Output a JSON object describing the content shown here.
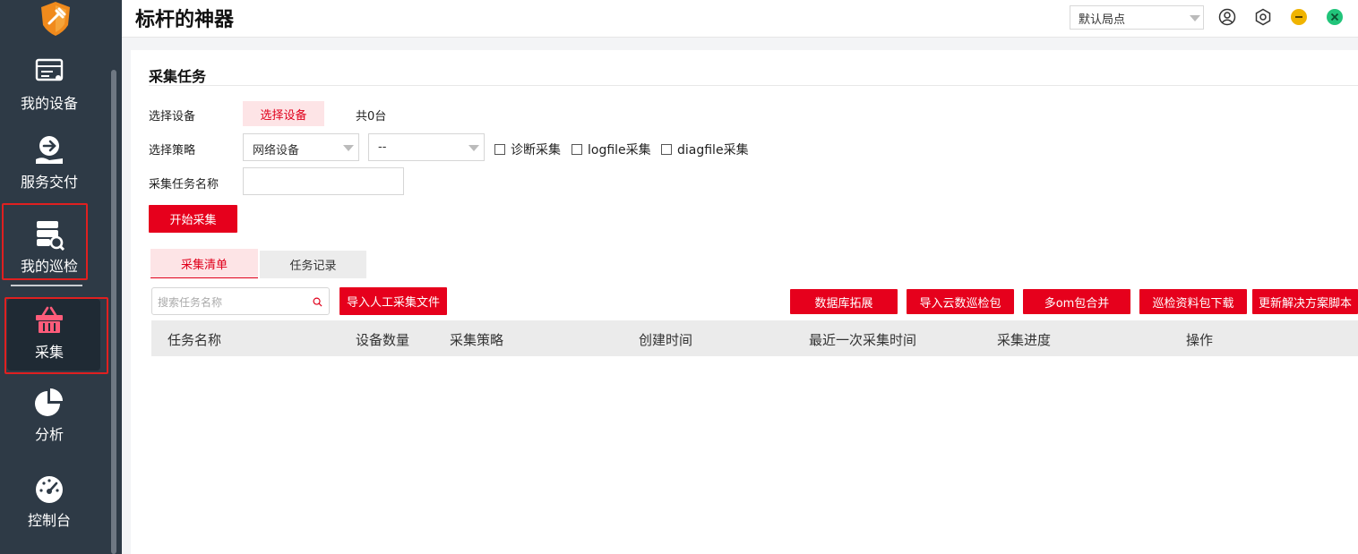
{
  "app": {
    "title": "标杆的神器"
  },
  "header": {
    "site_select": "默认局点",
    "icons": [
      "user-icon",
      "settings-icon",
      "minimize-icon",
      "close-icon"
    ]
  },
  "sidebar": {
    "items": [
      {
        "label": "我的设备",
        "icon": "device-list-icon"
      },
      {
        "label": "服务交付",
        "icon": "service-delivery-icon"
      },
      {
        "label": "我的巡检",
        "icon": "inspection-icon",
        "highlighted": true
      },
      {
        "label": "采集",
        "icon": "collect-basket-icon",
        "active": true,
        "highlighted": true
      },
      {
        "label": "分析",
        "icon": "pie-chart-icon"
      },
      {
        "label": "控制台",
        "icon": "dashboard-gauge-icon"
      }
    ]
  },
  "panel": {
    "title": "采集任务",
    "select_device_label": "选择设备",
    "select_device_button": "选择设备",
    "device_count": "共0台",
    "strategy_label": "选择策略",
    "strategy_value": "网络设备",
    "strategy_sub_value": "--",
    "checkboxes": [
      "诊断采集",
      "logfile采集",
      "diagfile采集"
    ],
    "task_name_label": "采集任务名称",
    "task_name_value": "",
    "start_button": "开始采集"
  },
  "tabs": [
    {
      "label": "采集清单",
      "active": true
    },
    {
      "label": "任务记录",
      "active": false
    }
  ],
  "toolbar": {
    "search_placeholder": "搜索任务名称",
    "import_manual": "导入人工采集文件",
    "actions": [
      "数据库拓展",
      "导入云数巡检包",
      "多om包合并",
      "巡检资料包下载",
      "更新解决方案脚本"
    ]
  },
  "table": {
    "columns": [
      "任务名称",
      "设备数量",
      "采集策略",
      "创建时间",
      "最近一次采集时间",
      "采集进度",
      "操作"
    ],
    "rows": []
  },
  "colors": {
    "accent": "#e6001c",
    "sidebar": "#2e3a46",
    "pink": "#fde4e6"
  }
}
